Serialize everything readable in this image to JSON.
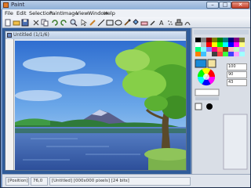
{
  "window": {
    "title": "Paint"
  },
  "menu": [
    "File",
    "Edit",
    "Selection",
    "Paint",
    "Image",
    "View",
    "Window",
    "Help"
  ],
  "document": {
    "title": "Untitled (1/1/6)"
  },
  "palette": {
    "hex_values": [
      "100",
      "90",
      "43"
    ]
  },
  "status": {
    "tool": "[Position]",
    "coords": "76,0",
    "info": "[Untitled]  [000x000 pixels]  [24 bits]"
  },
  "colors": {
    "accent": "#2f5c9a",
    "titlebar": "#8fb0d8"
  }
}
